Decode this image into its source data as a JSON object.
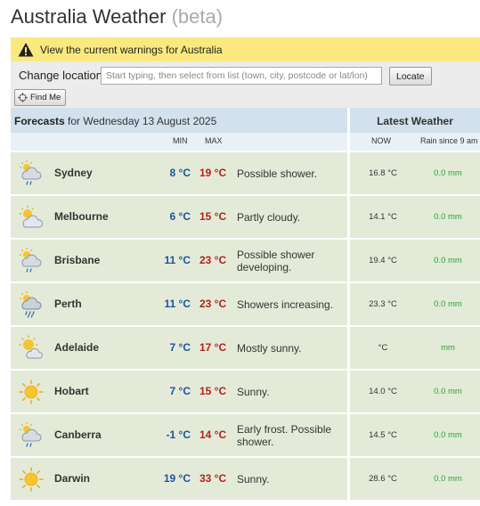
{
  "header": {
    "title": "Australia Weather",
    "beta": "(beta)"
  },
  "warnings": {
    "text": "View the current warnings for Australia",
    "icon": "warning-triangle-icon"
  },
  "location": {
    "label": "Change location",
    "placeholder": "Start typing, then select from list (town, city, postcode or lat/lon)",
    "locate_label": "Locate",
    "findme_label": "Find Me"
  },
  "forecast_header": {
    "prefix": "Forecasts",
    "date_text": " for Wednesday 13 August 2025",
    "min": "MIN",
    "max": "MAX"
  },
  "latest_header": {
    "title": "Latest Weather",
    "now": "NOW",
    "rain": "Rain since 9 am"
  },
  "cities": [
    {
      "name": "Sydney",
      "min": "8 °C",
      "max": "19 °C",
      "condition": "Possible shower.",
      "now": "16.8 °C",
      "rain": "0.0 mm",
      "icon": "shower-icon"
    },
    {
      "name": "Melbourne",
      "min": "6 °C",
      "max": "15 °C",
      "condition": "Partly cloudy.",
      "now": "14.1 °C",
      "rain": "0.0 mm",
      "icon": "partly-cloudy-icon"
    },
    {
      "name": "Brisbane",
      "min": "11 °C",
      "max": "23 °C",
      "condition": "Possible shower developing.",
      "now": "19.4 °C",
      "rain": "0.0 mm",
      "icon": "shower-icon"
    },
    {
      "name": "Perth",
      "min": "11 °C",
      "max": "23 °C",
      "condition": "Showers increasing.",
      "now": "23.3 °C",
      "rain": "0.0 mm",
      "icon": "showers-icon"
    },
    {
      "name": "Adelaide",
      "min": "7 °C",
      "max": "17 °C",
      "condition": "Mostly sunny.",
      "now": "°C",
      "rain": "mm",
      "icon": "mostly-sunny-icon"
    },
    {
      "name": "Hobart",
      "min": "7 °C",
      "max": "15 °C",
      "condition": "Sunny.",
      "now": "14.0 °C",
      "rain": "0.0 mm",
      "icon": "sunny-icon"
    },
    {
      "name": "Canberra",
      "min": "-1 °C",
      "max": "14 °C",
      "condition": "Early frost. Possible shower.",
      "now": "14.5 °C",
      "rain": "0.0 mm",
      "icon": "shower-icon"
    },
    {
      "name": "Darwin",
      "min": "19 °C",
      "max": "33 °C",
      "condition": "Sunny.",
      "now": "28.6 °C",
      "rain": "0.0 mm",
      "icon": "sunny-icon"
    }
  ],
  "colors": {
    "min_temp": "#1c52a4",
    "max_temp": "#b3211d",
    "rain": "#27a33a",
    "warning_bg": "#fbe97f",
    "row_bg": "#e3ebd8",
    "header_bg": "#d2e1ed"
  }
}
